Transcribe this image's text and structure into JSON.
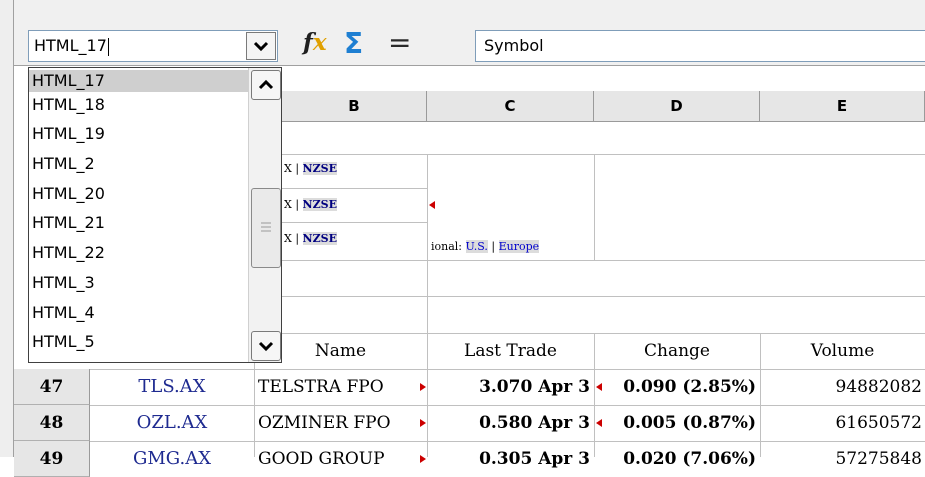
{
  "toolbar": {
    "name_box_value": "HTML_17",
    "formula_value": "Symbol"
  },
  "icons": {
    "function_wizard": "fx-icon",
    "sum": "sum-icon",
    "equals": "equals-icon"
  },
  "columns": [
    "B",
    "C",
    "D",
    "E"
  ],
  "links": {
    "x_nzse_1_a": "X |",
    "x_nzse_1_b": "NZSE",
    "x_nzse_2_a": "X |",
    "x_nzse_2_b": "NZSE",
    "x_nzse_3_a": "X |",
    "x_nzse_3_b": "NZSE",
    "international_prefix": "ional:",
    "us_link": "U.S.",
    "sep": "|",
    "europe_link": "Europe"
  },
  "table_header": {
    "name": "Name",
    "last_trade": "Last Trade",
    "change": "Change",
    "volume": "Volume"
  },
  "rows": [
    {
      "num": "47",
      "symbol": "TLS.AX",
      "name": "TELSTRA FPO",
      "last_trade": "3.070 Apr 3",
      "change": "0.090 (2.85%)",
      "volume": "94882082"
    },
    {
      "num": "48",
      "symbol": "OZL.AX",
      "name": "OZMINER FPO",
      "last_trade": "0.580 Apr 3",
      "change": "0.005 (0.87%)",
      "volume": "61650572"
    },
    {
      "num": "49",
      "symbol": "GMG.AX",
      "name": "GOOD GROUP",
      "last_trade": "0.305 Apr 3",
      "change": "0.020 (7.06%)",
      "volume": "57275848"
    }
  ],
  "dropdown": {
    "items": [
      "HTML_17",
      "HTML_18",
      "HTML_19",
      "HTML_2",
      "HTML_20",
      "HTML_21",
      "HTML_22",
      "HTML_3",
      "HTML_4",
      "HTML_5"
    ],
    "selected_index": 0
  },
  "colors": {
    "accent_link": "#1e2a90",
    "header_bg": "#e6e6e6",
    "indicator_red": "#cc0000"
  }
}
